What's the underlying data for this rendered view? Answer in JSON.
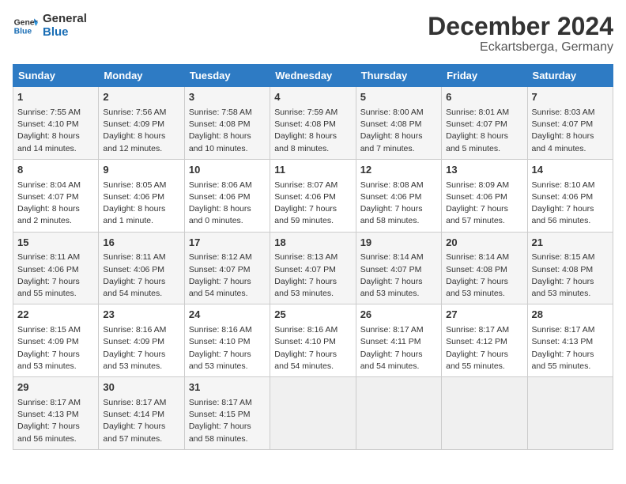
{
  "header": {
    "logo_line1": "General",
    "logo_line2": "Blue",
    "month": "December 2024",
    "location": "Eckartsberga, Germany"
  },
  "weekdays": [
    "Sunday",
    "Monday",
    "Tuesday",
    "Wednesday",
    "Thursday",
    "Friday",
    "Saturday"
  ],
  "weeks": [
    [
      {
        "day": "1",
        "info": "Sunrise: 7:55 AM\nSunset: 4:10 PM\nDaylight: 8 hours and 14 minutes."
      },
      {
        "day": "2",
        "info": "Sunrise: 7:56 AM\nSunset: 4:09 PM\nDaylight: 8 hours and 12 minutes."
      },
      {
        "day": "3",
        "info": "Sunrise: 7:58 AM\nSunset: 4:08 PM\nDaylight: 8 hours and 10 minutes."
      },
      {
        "day": "4",
        "info": "Sunrise: 7:59 AM\nSunset: 4:08 PM\nDaylight: 8 hours and 8 minutes."
      },
      {
        "day": "5",
        "info": "Sunrise: 8:00 AM\nSunset: 4:08 PM\nDaylight: 8 hours and 7 minutes."
      },
      {
        "day": "6",
        "info": "Sunrise: 8:01 AM\nSunset: 4:07 PM\nDaylight: 8 hours and 5 minutes."
      },
      {
        "day": "7",
        "info": "Sunrise: 8:03 AM\nSunset: 4:07 PM\nDaylight: 8 hours and 4 minutes."
      }
    ],
    [
      {
        "day": "8",
        "info": "Sunrise: 8:04 AM\nSunset: 4:07 PM\nDaylight: 8 hours and 2 minutes."
      },
      {
        "day": "9",
        "info": "Sunrise: 8:05 AM\nSunset: 4:06 PM\nDaylight: 8 hours and 1 minute."
      },
      {
        "day": "10",
        "info": "Sunrise: 8:06 AM\nSunset: 4:06 PM\nDaylight: 8 hours and 0 minutes."
      },
      {
        "day": "11",
        "info": "Sunrise: 8:07 AM\nSunset: 4:06 PM\nDaylight: 7 hours and 59 minutes."
      },
      {
        "day": "12",
        "info": "Sunrise: 8:08 AM\nSunset: 4:06 PM\nDaylight: 7 hours and 58 minutes."
      },
      {
        "day": "13",
        "info": "Sunrise: 8:09 AM\nSunset: 4:06 PM\nDaylight: 7 hours and 57 minutes."
      },
      {
        "day": "14",
        "info": "Sunrise: 8:10 AM\nSunset: 4:06 PM\nDaylight: 7 hours and 56 minutes."
      }
    ],
    [
      {
        "day": "15",
        "info": "Sunrise: 8:11 AM\nSunset: 4:06 PM\nDaylight: 7 hours and 55 minutes."
      },
      {
        "day": "16",
        "info": "Sunrise: 8:11 AM\nSunset: 4:06 PM\nDaylight: 7 hours and 54 minutes."
      },
      {
        "day": "17",
        "info": "Sunrise: 8:12 AM\nSunset: 4:07 PM\nDaylight: 7 hours and 54 minutes."
      },
      {
        "day": "18",
        "info": "Sunrise: 8:13 AM\nSunset: 4:07 PM\nDaylight: 7 hours and 53 minutes."
      },
      {
        "day": "19",
        "info": "Sunrise: 8:14 AM\nSunset: 4:07 PM\nDaylight: 7 hours and 53 minutes."
      },
      {
        "day": "20",
        "info": "Sunrise: 8:14 AM\nSunset: 4:08 PM\nDaylight: 7 hours and 53 minutes."
      },
      {
        "day": "21",
        "info": "Sunrise: 8:15 AM\nSunset: 4:08 PM\nDaylight: 7 hours and 53 minutes."
      }
    ],
    [
      {
        "day": "22",
        "info": "Sunrise: 8:15 AM\nSunset: 4:09 PM\nDaylight: 7 hours and 53 minutes."
      },
      {
        "day": "23",
        "info": "Sunrise: 8:16 AM\nSunset: 4:09 PM\nDaylight: 7 hours and 53 minutes."
      },
      {
        "day": "24",
        "info": "Sunrise: 8:16 AM\nSunset: 4:10 PM\nDaylight: 7 hours and 53 minutes."
      },
      {
        "day": "25",
        "info": "Sunrise: 8:16 AM\nSunset: 4:10 PM\nDaylight: 7 hours and 54 minutes."
      },
      {
        "day": "26",
        "info": "Sunrise: 8:17 AM\nSunset: 4:11 PM\nDaylight: 7 hours and 54 minutes."
      },
      {
        "day": "27",
        "info": "Sunrise: 8:17 AM\nSunset: 4:12 PM\nDaylight: 7 hours and 55 minutes."
      },
      {
        "day": "28",
        "info": "Sunrise: 8:17 AM\nSunset: 4:13 PM\nDaylight: 7 hours and 55 minutes."
      }
    ],
    [
      {
        "day": "29",
        "info": "Sunrise: 8:17 AM\nSunset: 4:13 PM\nDaylight: 7 hours and 56 minutes."
      },
      {
        "day": "30",
        "info": "Sunrise: 8:17 AM\nSunset: 4:14 PM\nDaylight: 7 hours and 57 minutes."
      },
      {
        "day": "31",
        "info": "Sunrise: 8:17 AM\nSunset: 4:15 PM\nDaylight: 7 hours and 58 minutes."
      },
      {
        "day": "",
        "info": ""
      },
      {
        "day": "",
        "info": ""
      },
      {
        "day": "",
        "info": ""
      },
      {
        "day": "",
        "info": ""
      }
    ]
  ]
}
